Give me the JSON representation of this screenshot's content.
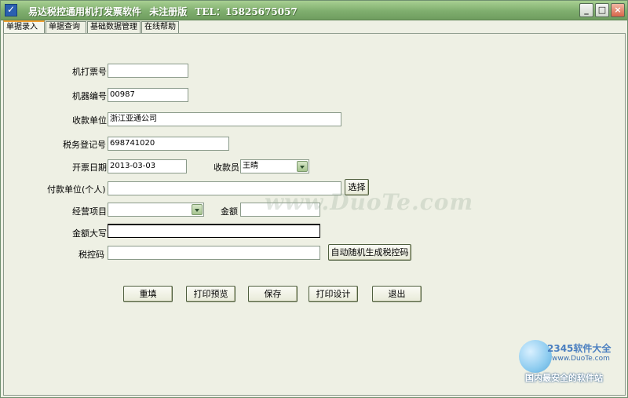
{
  "window": {
    "title_parts": [
      "易达税控通用机打发票软件",
      "未注册版",
      "TEL：15825675057"
    ],
    "minimize": "_",
    "maximize": "□",
    "close": "×"
  },
  "tabs": [
    {
      "label": "单据录入",
      "active": true
    },
    {
      "label": "单据查询",
      "active": false
    },
    {
      "label": "基础数据管理",
      "active": false
    },
    {
      "label": "在线帮助",
      "active": false
    }
  ],
  "form": {
    "printed_invoice_no": {
      "label": "机打票号",
      "value": ""
    },
    "machine_no": {
      "label": "机器编号",
      "value": "00987"
    },
    "payee_unit": {
      "label": "收款单位",
      "value": "浙江亚通公司"
    },
    "tax_reg_no": {
      "label": "税务登记号",
      "value": "698741020"
    },
    "issue_date": {
      "label": "开票日期",
      "value": "2013-03-03"
    },
    "cashier": {
      "label": "收款员",
      "value": "王晴"
    },
    "payer_unit": {
      "label": "付款单位(个人)",
      "value": ""
    },
    "select_button": "选择",
    "business_item": {
      "label": "经营项目",
      "value": ""
    },
    "amount": {
      "label": "金额",
      "value": ""
    },
    "amount_in_words": {
      "label": "金额大写",
      "value": ""
    },
    "tax_code": {
      "label": "税控码",
      "value": ""
    },
    "auto_generate_button": "自动随机生成税控码"
  },
  "actions": {
    "reset": "重填",
    "print_preview": "打印预览",
    "save": "保存",
    "print_design": "打印设计",
    "exit": "退出"
  },
  "watermark": {
    "site": "www.DuoTe.com",
    "brand": "2345软件大全",
    "url": "www.DuoTe.com",
    "tagline": "国内最安全的软件站"
  },
  "colors": {
    "titlebar": "#7fae6e",
    "background": "#eef0e4",
    "active_tab_accent": "#f0a030"
  }
}
